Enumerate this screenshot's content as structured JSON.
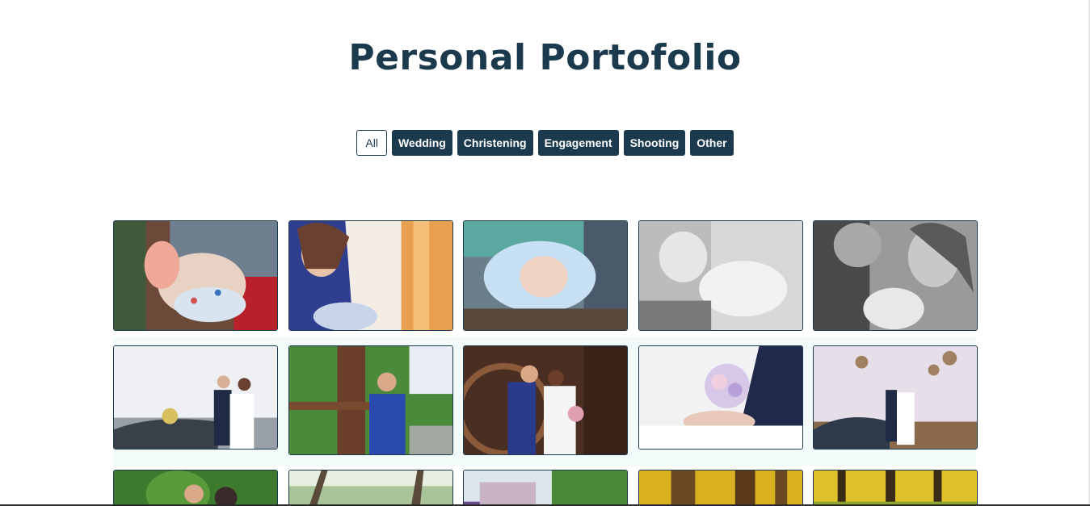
{
  "header": {
    "title": "Personal Portofolio"
  },
  "filters": [
    {
      "label": "All",
      "active": true
    },
    {
      "label": "Wedding",
      "active": false
    },
    {
      "label": "Christening",
      "active": false
    },
    {
      "label": "Engagement",
      "active": false
    },
    {
      "label": "Shooting",
      "active": false
    },
    {
      "label": "Other",
      "active": false
    }
  ],
  "colors": {
    "primary": "#1c3a4e",
    "background": "#ffffff",
    "gallery_tint": "#f3fafa"
  },
  "gallery": {
    "items": [
      {
        "subject": "baby-feet-photo"
      },
      {
        "subject": "mother-with-baby-photo"
      },
      {
        "subject": "baby-in-blanket-photo"
      },
      {
        "subject": "baby-black-white-photo"
      },
      {
        "subject": "family-black-white-photo"
      },
      {
        "subject": "couple-car-flowers-photo"
      },
      {
        "subject": "groom-wooden-fence-photo"
      },
      {
        "subject": "couple-wooden-wheel-photo"
      },
      {
        "subject": "hands-bouquet-photo"
      },
      {
        "subject": "couple-field-car-photo"
      },
      {
        "subject": "couple-green-garden-photo"
      },
      {
        "subject": "forest-path-photo"
      },
      {
        "subject": "building-garden-photo"
      },
      {
        "subject": "autumn-forest-photo"
      },
      {
        "subject": "yellow-forest-photo"
      }
    ]
  }
}
